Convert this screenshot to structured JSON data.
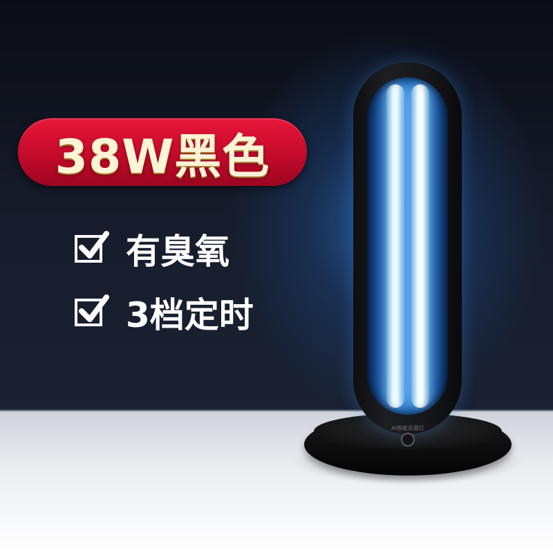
{
  "badge": {
    "text": "38W黑色",
    "color": "#d0102f"
  },
  "features": [
    {
      "icon": "checkbox-checked-icon",
      "label": "有臭氧"
    },
    {
      "icon": "checkbox-checked-icon",
      "label": "3档定时"
    }
  ],
  "product": {
    "name": "uv-lamp",
    "base_print": "AI智能杀菌灯"
  },
  "colors": {
    "background_dark": "#161c2b",
    "glow": "#2a6ebe",
    "floor": "#ffffff",
    "text": "#ffffff"
  }
}
